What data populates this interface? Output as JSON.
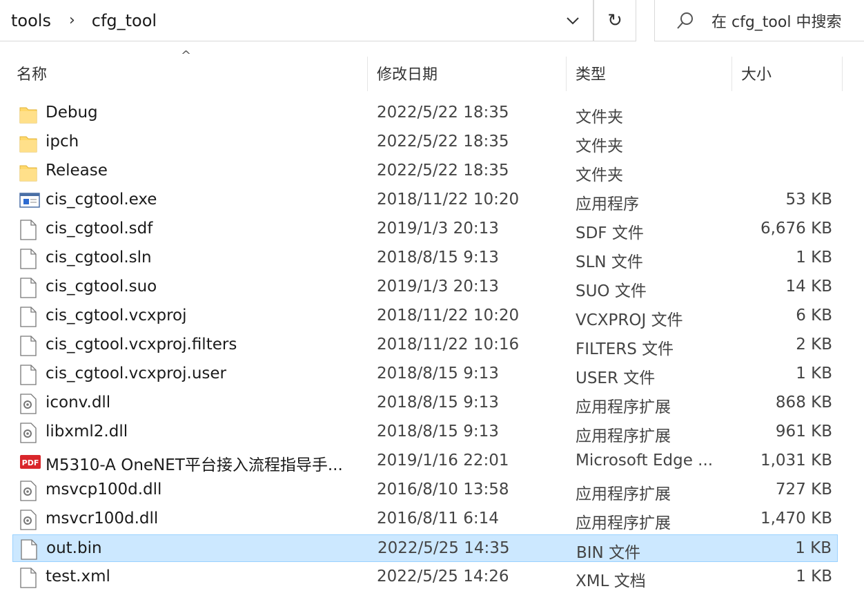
{
  "address_bar": {
    "breadcrumbs": [
      "tools",
      "cfg_tool"
    ],
    "dropdown_icon": "chevron-down-icon",
    "refresh_icon": "refresh-icon"
  },
  "search": {
    "placeholder": "在 cfg_tool 中搜索"
  },
  "columns": {
    "name": "名称",
    "date": "修改日期",
    "type": "类型",
    "size": "大小"
  },
  "files": [
    {
      "name": "Debug",
      "date": "2022/5/22 18:35",
      "type": "文件夹",
      "size": "",
      "icon": "folder-icon"
    },
    {
      "name": "ipch",
      "date": "2022/5/22 18:35",
      "type": "文件夹",
      "size": "",
      "icon": "folder-icon"
    },
    {
      "name": "Release",
      "date": "2022/5/22 18:35",
      "type": "文件夹",
      "size": "",
      "icon": "folder-icon"
    },
    {
      "name": "cis_cgtool.exe",
      "date": "2018/11/22 10:20",
      "type": "应用程序",
      "size": "53 KB",
      "icon": "exe-icon"
    },
    {
      "name": "cis_cgtool.sdf",
      "date": "2019/1/3 20:13",
      "type": "SDF 文件",
      "size": "6,676 KB",
      "icon": "file-icon"
    },
    {
      "name": "cis_cgtool.sln",
      "date": "2018/8/15 9:13",
      "type": "SLN 文件",
      "size": "1 KB",
      "icon": "file-icon"
    },
    {
      "name": "cis_cgtool.suo",
      "date": "2019/1/3 20:13",
      "type": "SUO 文件",
      "size": "14 KB",
      "icon": "file-icon"
    },
    {
      "name": "cis_cgtool.vcxproj",
      "date": "2018/11/22 10:20",
      "type": "VCXPROJ 文件",
      "size": "6 KB",
      "icon": "file-icon"
    },
    {
      "name": "cis_cgtool.vcxproj.filters",
      "date": "2018/11/22 10:16",
      "type": "FILTERS 文件",
      "size": "2 KB",
      "icon": "file-icon"
    },
    {
      "name": "cis_cgtool.vcxproj.user",
      "date": "2018/8/15 9:13",
      "type": "USER 文件",
      "size": "1 KB",
      "icon": "file-icon"
    },
    {
      "name": "iconv.dll",
      "date": "2018/8/15 9:13",
      "type": "应用程序扩展",
      "size": "868 KB",
      "icon": "dll-icon"
    },
    {
      "name": "libxml2.dll",
      "date": "2018/8/15 9:13",
      "type": "应用程序扩展",
      "size": "961 KB",
      "icon": "dll-icon"
    },
    {
      "name": "M5310-A OneNET平台接入流程指导手...",
      "date": "2019/1/16 22:01",
      "type": "Microsoft Edge ...",
      "size": "1,031 KB",
      "icon": "pdf-icon"
    },
    {
      "name": "msvcp100d.dll",
      "date": "2016/8/10 13:58",
      "type": "应用程序扩展",
      "size": "727 KB",
      "icon": "dll-icon"
    },
    {
      "name": "msvcr100d.dll",
      "date": "2016/8/11 6:14",
      "type": "应用程序扩展",
      "size": "1,470 KB",
      "icon": "dll-icon"
    },
    {
      "name": "out.bin",
      "date": "2022/5/25 14:35",
      "type": "BIN 文件",
      "size": "1 KB",
      "icon": "file-icon",
      "selected": true
    },
    {
      "name": "test.xml",
      "date": "2022/5/25 14:26",
      "type": "XML 文档",
      "size": "1 KB",
      "icon": "file-icon"
    }
  ],
  "colors": {
    "selection": "#cce8ff",
    "selection_border": "#99d1ff",
    "folder": "#ffd86b"
  }
}
